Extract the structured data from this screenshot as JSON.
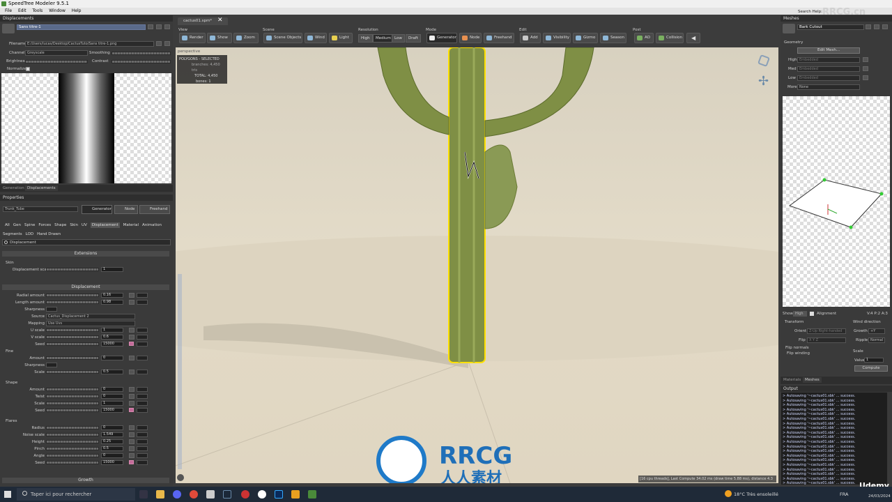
{
  "app": {
    "title": "SpeedTree Modeler 9.5.1",
    "menus": [
      "File",
      "Edit",
      "Tools",
      "Window",
      "Help"
    ]
  },
  "left_top": {
    "panel_title": "Displacements",
    "preset_name": "Sans titre-1",
    "filename_label": "Filename",
    "filename_value": "E:/Users/lucas/Desktop/CactusTuto/Sans titre-1.png",
    "channel_label": "Channel",
    "channel_value": "Greyscale",
    "smoothing_label": "Smoothing",
    "brightness_label": "Brightness",
    "contrast_label": "Contrast",
    "normalize_label": "Normalize",
    "tabs": [
      "Generation",
      "Displacements"
    ]
  },
  "properties": {
    "panel_title": "Properties",
    "object_name": "Trunk_Tube",
    "mode_buttons": [
      "Generator",
      "Node",
      "Freehand"
    ],
    "tabs_row1": [
      "All",
      "Gen",
      "Spine",
      "Forces",
      "Shape",
      "Skin",
      "UV",
      "Displacement",
      "Material",
      "Animation"
    ],
    "tabs_row2": [
      "Segments",
      "LOD",
      "Hand Drawn"
    ],
    "search_value": "Displacement",
    "extensions_header": "Extensions",
    "skin_label": "Skin",
    "displacement_scale_label": "Displacement scale",
    "displacement_scale_value": "1",
    "displacement_header": "Displacement",
    "rows": [
      {
        "label": "Radial amount",
        "value": "0.16"
      },
      {
        "label": "Length amount",
        "value": "0.98"
      },
      {
        "label": "Sharpness",
        "value": ""
      },
      {
        "label": "Source",
        "value": "Cactus_Displacement 2"
      },
      {
        "label": "Mapping",
        "value": "Use Uvs"
      },
      {
        "label": "U scale",
        "value": "1"
      },
      {
        "label": "V scale",
        "value": "0.6"
      },
      {
        "label": "Seed",
        "value": "15000"
      }
    ],
    "fine_label": "Fine",
    "fine_rows": [
      {
        "label": "Amount",
        "value": "0"
      },
      {
        "label": "Sharpness",
        "value": ""
      },
      {
        "label": "Scale",
        "value": "0.5"
      }
    ],
    "shape_label": "Shape",
    "shape_rows": [
      {
        "label": "Amount",
        "value": "0"
      },
      {
        "label": "Twist",
        "value": "0"
      },
      {
        "label": "Scale",
        "value": "1"
      },
      {
        "label": "Seed",
        "value": "15000"
      }
    ],
    "flares_label": "Flares",
    "flares_rows": [
      {
        "label": "Radius",
        "value": "0"
      },
      {
        "label": "Noise scale",
        "value": "1.549"
      },
      {
        "label": "Height",
        "value": "0.25"
      },
      {
        "label": "Pinch",
        "value": "0.5"
      },
      {
        "label": "Angle",
        "value": "0"
      },
      {
        "label": "Seed",
        "value": "15000"
      }
    ],
    "growth_header": "Growth"
  },
  "toolbar": {
    "doc_tab": "cactus01.spm*",
    "groups": [
      "View",
      "Scene",
      "Resolution",
      "Mode",
      "Edit",
      "Post"
    ],
    "view_buttons": [
      "Render",
      "Show",
      "Zoom"
    ],
    "scene_buttons": [
      "Scene Objects",
      "Wind",
      "Light"
    ],
    "resolution_buttons": [
      "High",
      "Medium",
      "Low",
      "Draft"
    ],
    "mode_buttons": [
      "Generator",
      "Node",
      "Freehand"
    ],
    "edit_buttons": [
      "Add",
      "Visibility",
      "Gizmo",
      "Season"
    ],
    "post_buttons": [
      "AO",
      "Collision"
    ]
  },
  "viewport": {
    "camera_label": "perspective",
    "stats_title": "POLYGONS - SELECTED",
    "stats_branches": "branches: 4,450 tris",
    "stats_total": "TOTAL: 4,450",
    "stats_bones": "bones: 1",
    "status_line": "[16 cpu threads], Last Compute 34.02 ms (draw time 5.88 ms), distance 4.3",
    "watermark_text": "RRCG",
    "watermark_sub": "人人素材"
  },
  "right": {
    "meshes_title": "Meshes",
    "search_help": "Search Help:",
    "mesh_name": "Bark Cutout",
    "geometry_label": "Geometry",
    "edit_mesh_button": "Edit Mesh...",
    "lod_rows": [
      {
        "label": "High",
        "value": "Embedded"
      },
      {
        "label": "Med",
        "value": "Embedded"
      },
      {
        "label": "Low",
        "value": "Embedded"
      }
    ],
    "more_label": "More",
    "more_value": "None",
    "show_label": "Show",
    "show_value": "High",
    "alignment_label": "Alignment",
    "vertex_info": "V:4 P:2 A:3",
    "transform_label": "Transform",
    "orient_label": "Orient",
    "orient_value": "Z-Up Right-handed",
    "flip_label": "Flip",
    "flip_value": "X Y Z",
    "flip_normals": "Flip normals",
    "flip_winding": "Flip winding",
    "wind_direction_label": "Wind direction",
    "growth_label": "Growth",
    "growth_value": "+Y",
    "ripple_label": "Ripple",
    "ripple_value": "Normal",
    "scale_label": "Scale",
    "value_label": "Value",
    "value_value": "1",
    "compute_button": "Compute",
    "bottom_tabs": [
      "Materials",
      "Meshes"
    ],
    "output_title": "Output",
    "output_lines": [
      "> Autosaving '~cactus01.sbk' ... success.",
      "> Autosaving '~cactus01.sbk' ... success.",
      "> Autosaving '~cactus01.sbk' ... success.",
      "> Autosaving '~cactus01.sbk' ... success.",
      "> Autosaving '~cactus01.sbk' ... success.",
      "> Autosaving '~cactus01.sbk' ... success.",
      "> Autosaving '~cactus01.sbk' ... success.",
      "> Autosaving '~cactus01.sbk' ... success.",
      "> Autosaving '~cactus01.sbk' ... success.",
      "> Autosaving '~cactus01.sbk' ... success.",
      "> Autosaving '~cactus01.sbk' ... success.",
      "> Autosaving '~cactus01.sbk' ... success.",
      "> Autosaving '~cactus01.sbk' ... success.",
      "> Autosaving '~cactus01.sbk' ... success.",
      "> Autosaving '~cactus01.sbk' ... success.",
      "> Autosaving '~cactus01.sbk' ... success.",
      "> Autosaving '~cactus01.sbk' ... success.",
      "> Autosaving '~cactus01.sbk' ... success.",
      "> Autosaving '~cactus01.sbk' ... success.",
      "> Autosaving '~cactus01.sbk' ... success."
    ],
    "corner_watermark": "RRCG.cn"
  },
  "taskbar": {
    "search_placeholder": "Taper ici pour rechercher",
    "weather": "18°C  Très ensoleillé",
    "lang": "FRA",
    "time": "",
    "date": "24/03/2024",
    "udemy": "Udemy"
  }
}
